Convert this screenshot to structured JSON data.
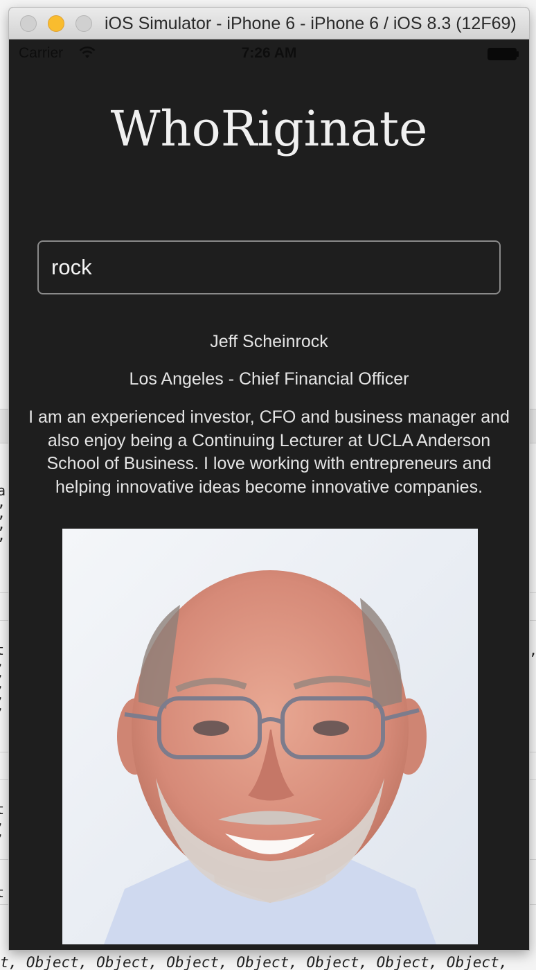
{
  "window": {
    "title": "iOS Simulator - iPhone 6 - iPhone 6 / iOS 8.3 (12F69)"
  },
  "statusbar": {
    "carrier": "Carrier",
    "time": "7:26 AM"
  },
  "app": {
    "title": "WhoRiginate",
    "search_value": "rock"
  },
  "result": {
    "name": "Jeff Scheinrock",
    "role": "Los Angeles - Chief Financial Officer",
    "bio": "I am an experienced investor, CFO and business manager and also enjoy being a Continuing Lecturer at UCLA Anderson School of Business. I love working with entrepreneurs and helping innovative ideas become innovative companies."
  },
  "background_console": {
    "bottom_line": "t, Object, Object, Object, Object, Object, Object, Object,"
  },
  "colors": {
    "app_background": "#1e1e1e",
    "app_text": "#f0f0f0",
    "minimize_button": "#f9bc2e"
  }
}
